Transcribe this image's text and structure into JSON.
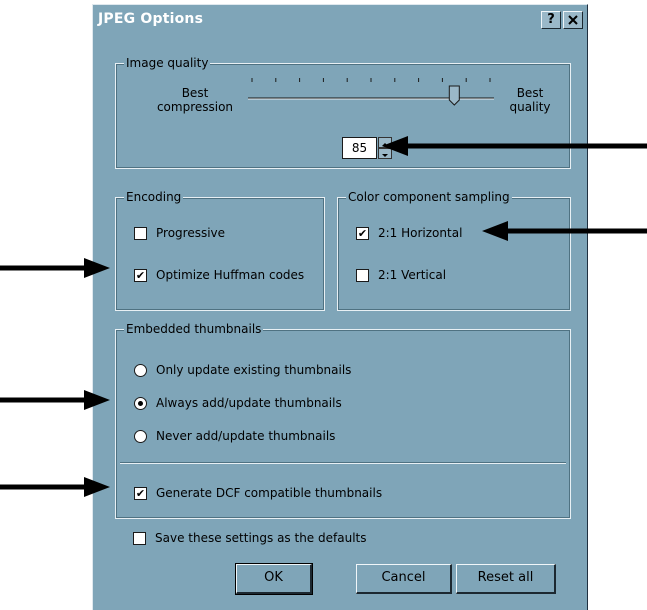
{
  "dialog": {
    "title": "JPEG Options",
    "help_button": "?",
    "close_button": "✕"
  },
  "image_quality": {
    "legend": "Image quality",
    "left_label_line1": "Best",
    "left_label_line2": "compression",
    "right_label_line1": "Best",
    "right_label_line2": "quality",
    "value": "85",
    "slider_min": 0,
    "slider_max": 100,
    "slider_value": 85
  },
  "encoding": {
    "legend": "Encoding",
    "progressive": {
      "label": "Progressive",
      "checked": false
    },
    "optimize_huffman": {
      "label": "Optimize Huffman codes",
      "checked": true
    }
  },
  "color_sampling": {
    "legend": "Color component sampling",
    "horizontal": {
      "label": "2:1 Horizontal",
      "checked": true
    },
    "vertical": {
      "label": "2:1 Vertical",
      "checked": false
    }
  },
  "thumbnails": {
    "legend": "Embedded thumbnails",
    "options": [
      {
        "label": "Only update existing thumbnails",
        "selected": false
      },
      {
        "label": "Always add/update thumbnails",
        "selected": true
      },
      {
        "label": "Never add/update thumbnails",
        "selected": false
      }
    ],
    "dcf": {
      "label": "Generate DCF compatible thumbnails",
      "checked": true
    }
  },
  "save_defaults": {
    "label": "Save these settings as the defaults",
    "checked": false
  },
  "buttons": {
    "ok": "OK",
    "cancel": "Cancel",
    "reset": "Reset all"
  },
  "colors": {
    "dialog_bg": "#7fa5b8",
    "arrow": "#000000"
  }
}
